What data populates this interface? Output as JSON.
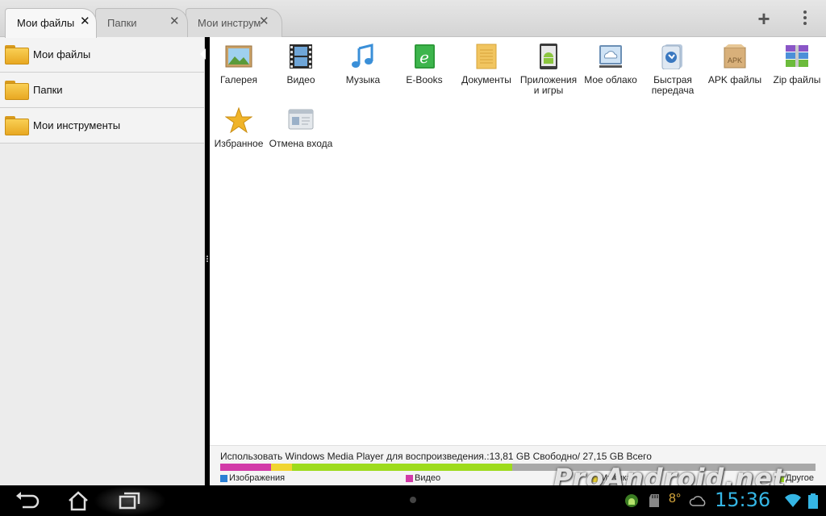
{
  "tabs": [
    {
      "label": "Мои файлы",
      "close": "✕",
      "active": true
    },
    {
      "label": "Папки",
      "close": "✕",
      "active": false
    },
    {
      "label": "Мои инструменты",
      "close": "✕",
      "active": false
    }
  ],
  "toolbar": {
    "add_icon": "plus-icon",
    "menu_icon": "overflow-menu-icon"
  },
  "sidebar": {
    "items": [
      {
        "label": "Мои файлы",
        "icon": "folder-icon"
      },
      {
        "label": "Папки",
        "icon": "folder-icon"
      },
      {
        "label": "Мои инструменты",
        "icon": "folder-icon"
      }
    ]
  },
  "grid": {
    "items": [
      {
        "label": "Галерея",
        "icon": "gallery-icon"
      },
      {
        "label": "Видео",
        "icon": "video-icon"
      },
      {
        "label": "Музыка",
        "icon": "music-icon"
      },
      {
        "label": "E-Books",
        "icon": "ebook-icon"
      },
      {
        "label": "Документы",
        "icon": "documents-icon"
      },
      {
        "label": "Приложения и игры",
        "icon": "apps-icon"
      },
      {
        "label": "Мое облако",
        "icon": "cloud-icon"
      },
      {
        "label": "Быстрая передача",
        "icon": "quick-transfer-icon"
      },
      {
        "label": "APK файлы",
        "icon": "apk-icon"
      },
      {
        "label": "Zip файлы",
        "icon": "zip-icon"
      },
      {
        "label": "Избранное",
        "icon": "star-icon"
      },
      {
        "label": "Отмена входа",
        "icon": "logout-icon"
      }
    ],
    "apk_badge": "APK"
  },
  "storage": {
    "text": "Использовать Windows Media Player для воспроизведения.:13,81 GB Свободно/ 27,15 GB Всего",
    "segments": [
      {
        "name": "Изображения",
        "color": "#2a7fd4",
        "fraction": 0.0
      },
      {
        "name": "Видео",
        "color": "#d23aa8",
        "fraction": 0.085
      },
      {
        "name": "Музыка",
        "color": "#f0d531",
        "fraction": 0.035
      },
      {
        "name": "Другое",
        "color": "#9ddb1d",
        "fraction": 0.37
      }
    ],
    "legend": [
      "Изображения",
      "Видео",
      "Музыка",
      "Другое"
    ]
  },
  "watermark": "ProAndroid.net",
  "statusbar": {
    "clock": "15:36",
    "temperature": "8°"
  }
}
